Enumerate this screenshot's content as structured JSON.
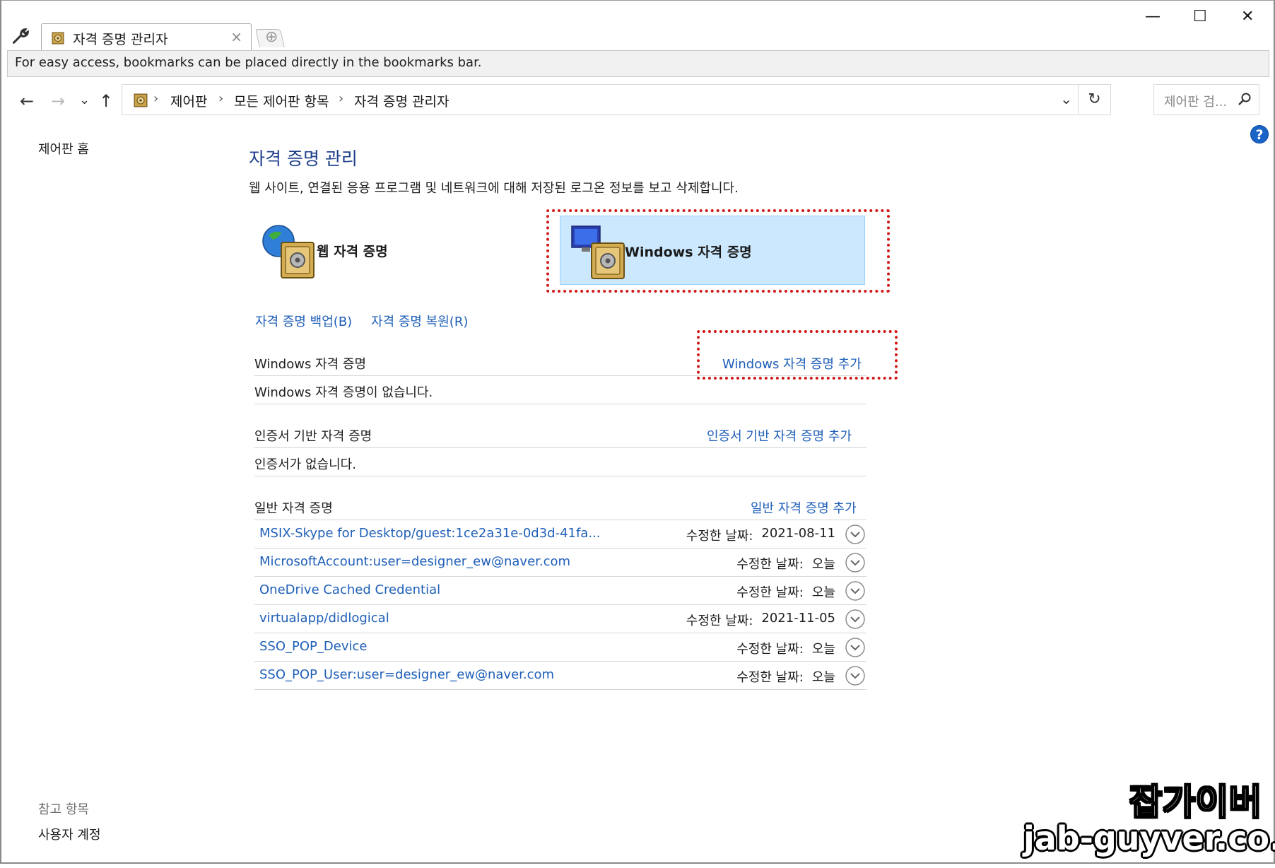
{
  "tab": {
    "title": "자격 증명 관리자",
    "close": "×",
    "new_tab": "⊕"
  },
  "window": {
    "minimize": "—",
    "maximize": "☐",
    "close": "✕"
  },
  "bookmarks_bar": {
    "text": "For easy access, bookmarks can be placed directly in the bookmarks bar."
  },
  "nav": {
    "back": "←",
    "forward": "→",
    "recent": "⌄",
    "up": "↑",
    "breadcrumbs": [
      "제어판",
      "모든 제어판 항목",
      "자격 증명 관리자"
    ],
    "crumb_separator": "›",
    "dropdown": "⌄",
    "refresh": "↻",
    "search_placeholder": "제어판 검..."
  },
  "help": {
    "label": "?"
  },
  "sidebar": {
    "home": "제어판 홈",
    "see_also_caption": "참고 항목",
    "see_also_items": [
      "사용자 계정"
    ]
  },
  "main": {
    "title": "자격 증명 관리",
    "description": "웹 사이트, 연결된 응용 프로그램 및 네트워크에 대해 저장된 로그온 정보를 보고 삭제합니다.",
    "vault_web_label": "웹 자격 증명",
    "vault_windows_label": "Windows 자격 증명",
    "backup_link": "자격 증명 백업(B)",
    "restore_link": "자격 증명 복원(R)",
    "windows_section": {
      "heading": "Windows 자격 증명",
      "add_link": "Windows 자격 증명 추가",
      "empty": "Windows 자격 증명이 없습니다."
    },
    "cert_section": {
      "heading": "인증서 기반 자격 증명",
      "add_link": "인증서 기반 자격 증명 추가",
      "empty": "인증서가 없습니다."
    },
    "generic_section": {
      "heading": "일반 자격 증명",
      "add_link": "일반 자격 증명 추가",
      "modified_label": "수정한 날짜:",
      "items": [
        {
          "name": "MSIX-Skype for Desktop/guest:1ce2a31e-0d3d-41fa...",
          "date": "2021-08-11"
        },
        {
          "name": "MicrosoftAccount:user=designer_ew@naver.com",
          "date": "오늘"
        },
        {
          "name": "OneDrive Cached Credential",
          "date": "오늘"
        },
        {
          "name": "virtualapp/didlogical",
          "date": "2021-11-05"
        },
        {
          "name": "SSO_POP_Device",
          "date": "오늘"
        },
        {
          "name": "SSO_POP_User:user=designer_ew@naver.com",
          "date": "오늘"
        }
      ]
    }
  },
  "watermark": {
    "name": "잡가이버",
    "url": "jab-guyver.co.kr"
  },
  "colors": {
    "link": "#1f5fb8",
    "title": "#1e3f8a",
    "selected_bg": "#cce8ff",
    "highlight_dash": "#d01818"
  }
}
